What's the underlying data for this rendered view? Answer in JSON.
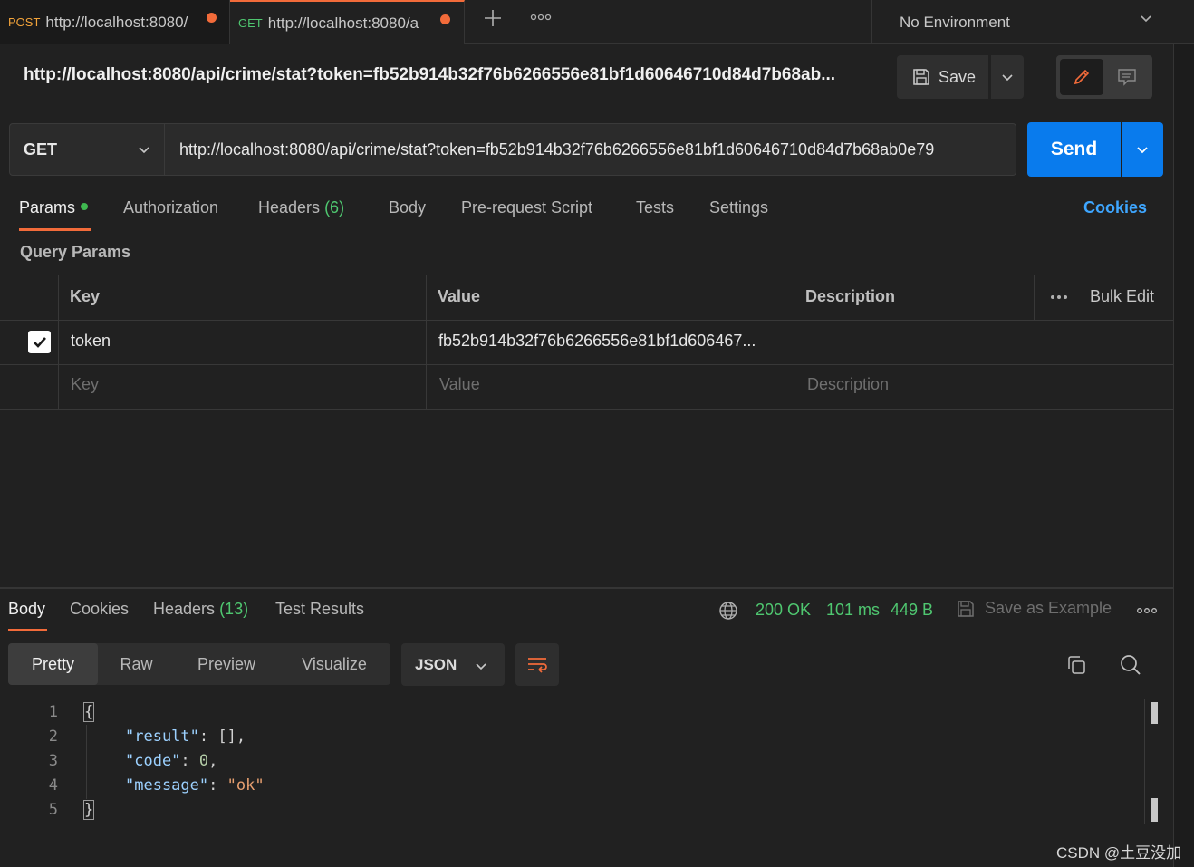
{
  "tabs": [
    {
      "method": "POST",
      "method_color": "#f2a33a",
      "url": "http://localhost:8080/"
    },
    {
      "method": "GET",
      "method_color": "#4fc770",
      "url": "http://localhost:8080/a"
    }
  ],
  "environment": {
    "label": "No Environment"
  },
  "request": {
    "title": "http://localhost:8080/api/crime/stat?token=fb52b914b32f76b6266556e81bf1d60646710d84d7b68ab...",
    "save_label": "Save",
    "method": "GET",
    "url": "http://localhost:8080/api/crime/stat?token=fb52b914b32f76b6266556e81bf1d60646710d84d7b68ab0e79",
    "send_label": "Send"
  },
  "request_tabs": {
    "params": "Params",
    "authorization": "Authorization",
    "headers": "Headers",
    "headers_count": "(6)",
    "body": "Body",
    "pre_request": "Pre-request Script",
    "tests": "Tests",
    "settings": "Settings",
    "cookies": "Cookies"
  },
  "query_params": {
    "title": "Query Params",
    "columns": {
      "key": "Key",
      "value": "Value",
      "description": "Description",
      "bulk_edit": "Bulk Edit"
    },
    "rows": [
      {
        "checked": true,
        "key": "token",
        "value": "fb52b914b32f76b6266556e81bf1d606467..."
      }
    ],
    "placeholders": {
      "key": "Key",
      "value": "Value",
      "description": "Description"
    }
  },
  "response_tabs": {
    "body": "Body",
    "cookies": "Cookies",
    "headers": "Headers",
    "headers_count": "(13)",
    "test_results": "Test Results"
  },
  "response_status": {
    "status": "200 OK",
    "time": "101 ms",
    "size": "449 B",
    "save_example": "Save as Example"
  },
  "view": {
    "modes": [
      "Pretty",
      "Raw",
      "Preview",
      "Visualize"
    ],
    "active_mode": "Pretty",
    "format": "JSON"
  },
  "code": {
    "line_numbers": [
      "1",
      "2",
      "3",
      "4",
      "5"
    ],
    "open_brace": "{",
    "close_brace": "}",
    "lines": [
      {
        "key": "\"result\"",
        "sep": ": ",
        "value": "[],",
        "value_type": "plain"
      },
      {
        "key": "\"code\"",
        "sep": ": ",
        "value": "0",
        "tail": ",",
        "value_type": "number"
      },
      {
        "key": "\"message\"",
        "sep": ": ",
        "value": "\"ok\"",
        "value_type": "string"
      }
    ]
  },
  "watermark": "CSDN @土豆没加",
  "colors": {
    "accent": "#f26b3a",
    "send": "#097bed",
    "status_ok": "#4fc770",
    "link": "#3ea6ff"
  }
}
